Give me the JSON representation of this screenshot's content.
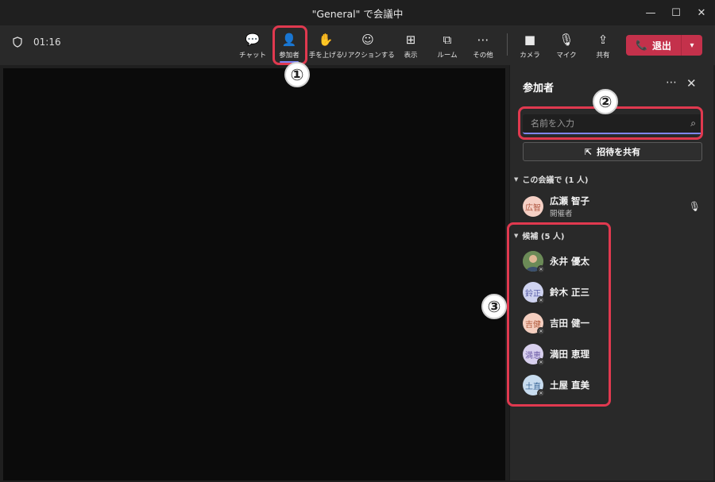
{
  "window": {
    "title": "\"General\" で会議中",
    "controls": {
      "minimize": "—",
      "maximize": "☐",
      "close": "✕"
    }
  },
  "toolbar": {
    "timer": "01:16",
    "buttons": [
      {
        "label": "チャット",
        "icon": "chat-icon",
        "glyph": "💬"
      },
      {
        "label": "参加者",
        "icon": "people-icon",
        "glyph": "👤"
      },
      {
        "label": "手を上げる",
        "icon": "raise-hand-icon",
        "glyph": "✋"
      },
      {
        "label": "リアクションする",
        "icon": "reaction-icon",
        "glyph": "☺"
      },
      {
        "label": "表示",
        "icon": "view-icon",
        "glyph": "⊞"
      },
      {
        "label": "ルーム",
        "icon": "rooms-icon",
        "glyph": "⧉"
      },
      {
        "label": "その他",
        "icon": "more-icon",
        "glyph": "⋯"
      },
      {
        "label": "カメラ",
        "icon": "camera-icon",
        "glyph": "■"
      },
      {
        "label": "マイク",
        "icon": "mic-icon",
        "glyph": "🎙"
      },
      {
        "label": "共有",
        "icon": "share-icon",
        "glyph": "⇪"
      }
    ],
    "leave_label": "退出"
  },
  "panel": {
    "title": "参加者",
    "search_placeholder": "名前を入力",
    "invite_label": "招待を共有",
    "in_meeting_header": "この会議で (1 人)",
    "in_meeting": [
      {
        "name": "広瀬 智子",
        "role": "開催者",
        "initials": "広智",
        "color": "#f5d0c5",
        "text_color": "#b15a44"
      }
    ],
    "suggested_header": "候補 (5 人)",
    "suggested": [
      {
        "name": "永井 優太",
        "initials": "",
        "color": "#5b7a4a",
        "text_color": "#ffffff"
      },
      {
        "name": "鈴木 正三",
        "initials": "鈴正",
        "color": "#cfd3f0",
        "text_color": "#5a5fa8"
      },
      {
        "name": "吉田 健一",
        "initials": "吉健",
        "color": "#f5cfc0",
        "text_color": "#b05a3c"
      },
      {
        "name": "満田 恵理",
        "initials": "満恵",
        "color": "#d8d0ee",
        "text_color": "#6b5aa5"
      },
      {
        "name": "土屋 直美",
        "initials": "土直",
        "color": "#c8dcef",
        "text_color": "#3f6a9a"
      }
    ]
  },
  "annotations": [
    "①",
    "②",
    "③"
  ],
  "colors": {
    "accent": "#7f85f5",
    "leave": "#c4314b",
    "callout": "#e0394f"
  }
}
